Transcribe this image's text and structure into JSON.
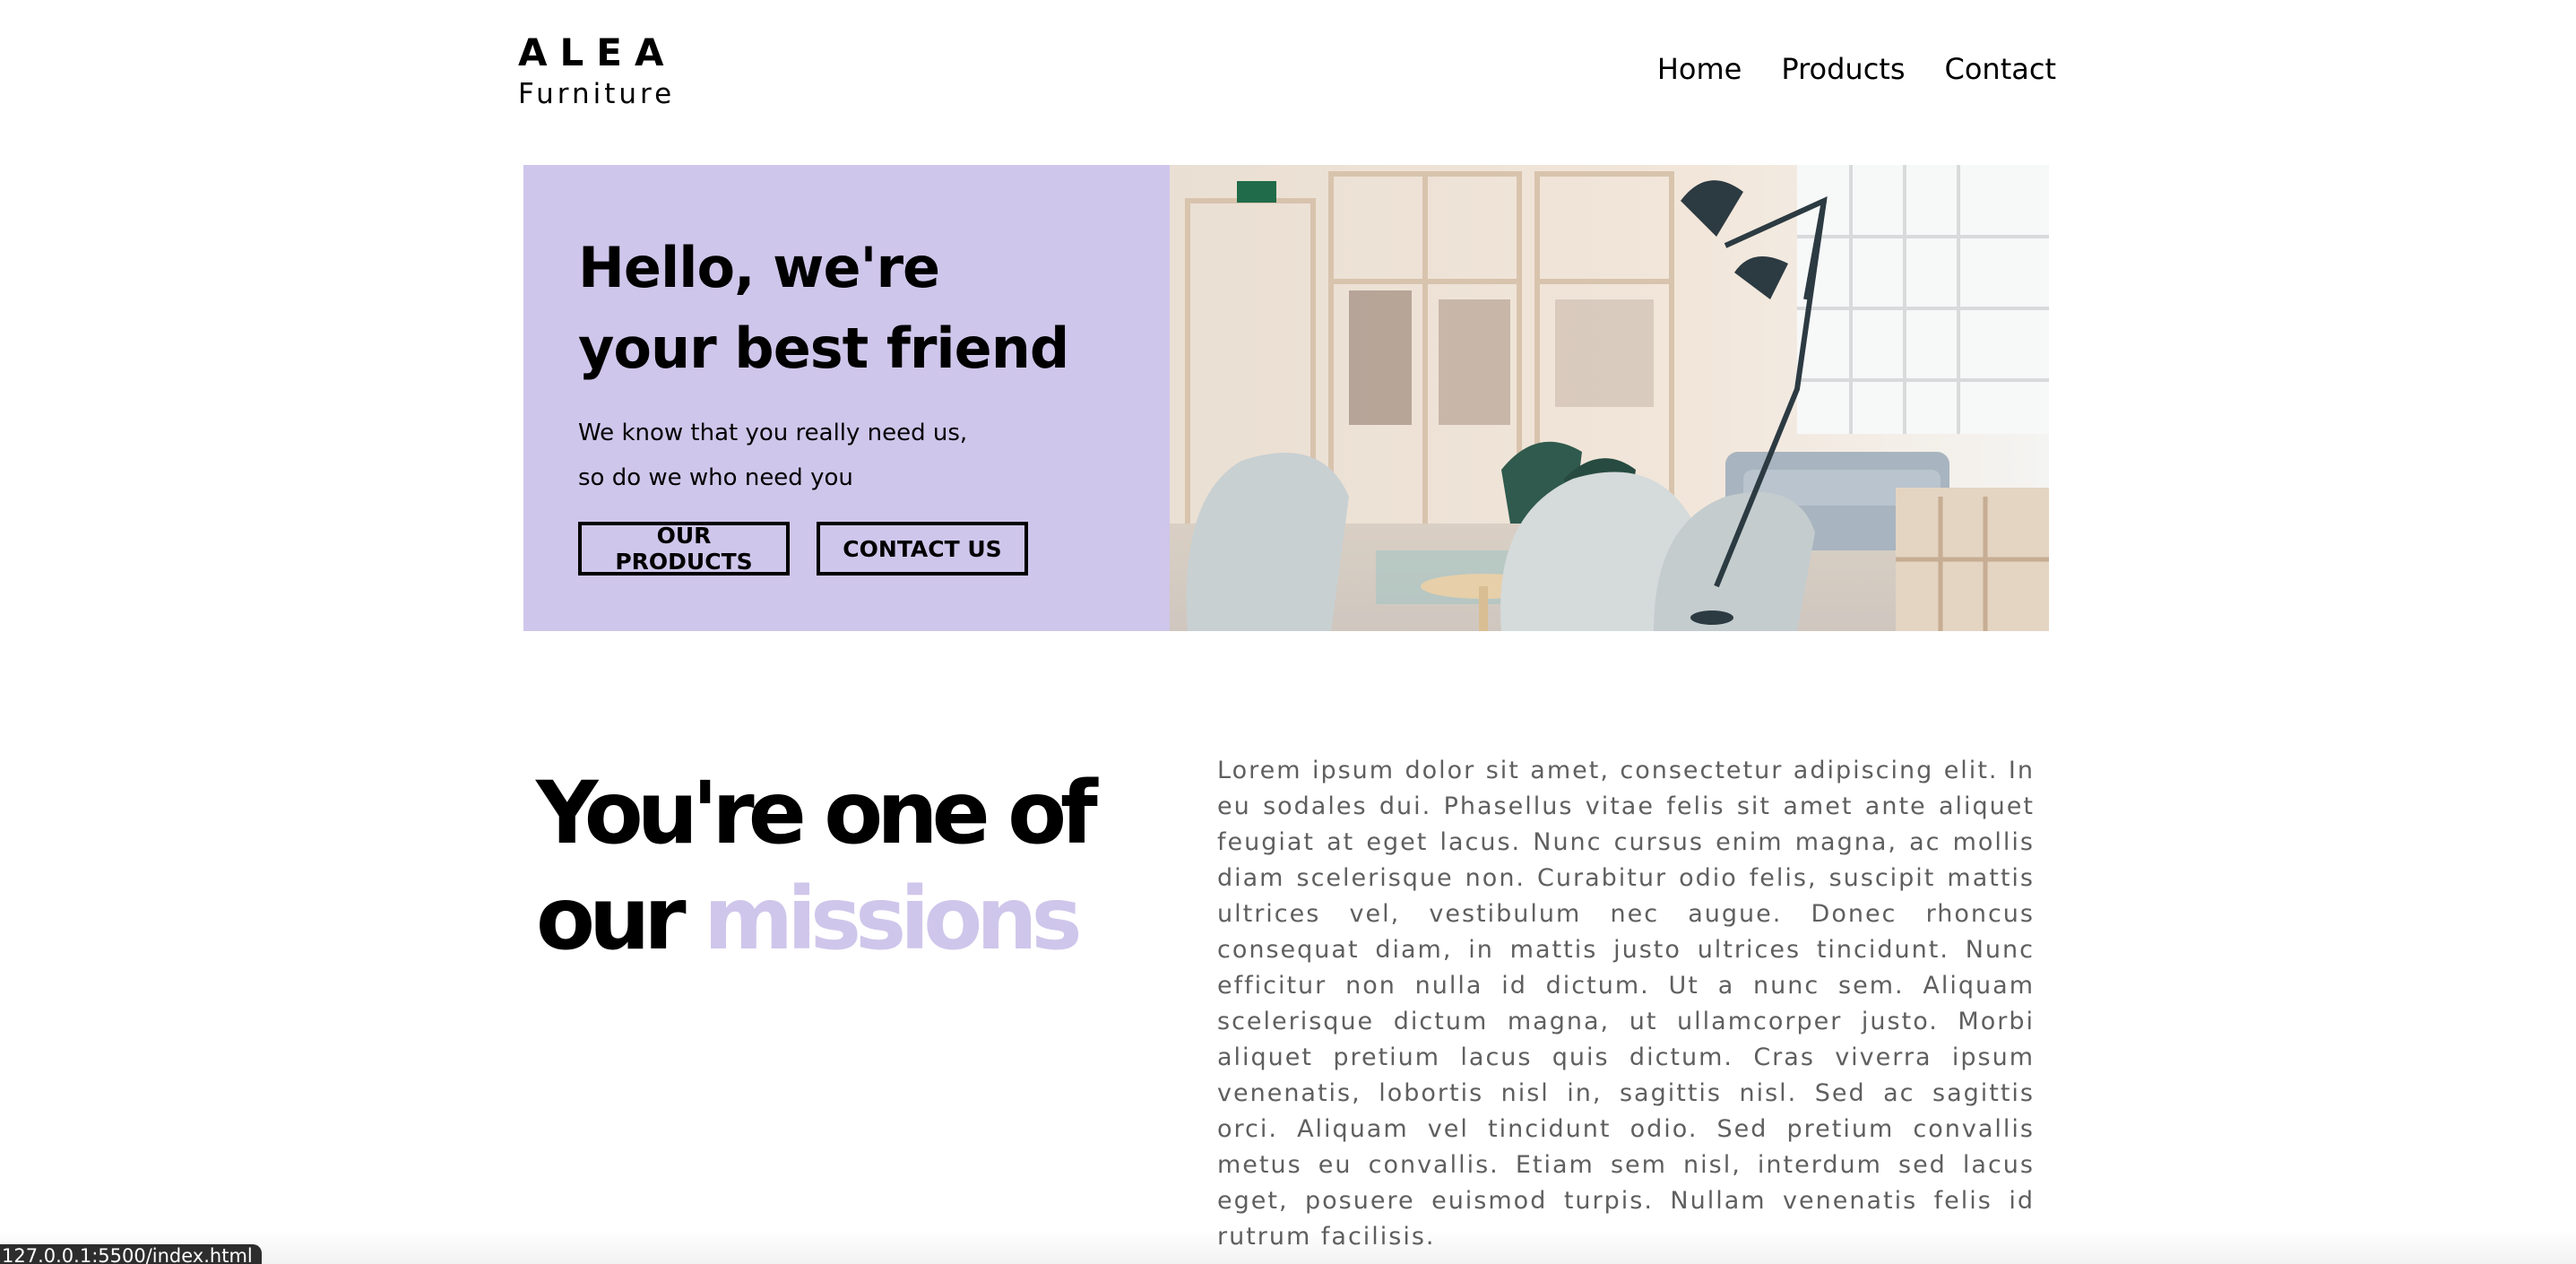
{
  "header": {
    "logo_mark": "ALEA",
    "logo_sub": "Furniture",
    "nav": [
      {
        "label": "Home"
      },
      {
        "label": "Products"
      },
      {
        "label": "Contact"
      }
    ]
  },
  "hero": {
    "title_line1": "Hello, we're",
    "title_line2": "your best friend",
    "text_line1": "We know that you really need us,",
    "text_line2": "so do we who need you",
    "primary_button": "OUR PRODUCTS",
    "secondary_button": "CONTACT US",
    "image_icon": "interior-photo"
  },
  "mission": {
    "title_line1": "You're one of",
    "title_word": "our",
    "title_accent": "missions",
    "body": "Lorem ipsum dolor sit amet, consectetur adipiscing elit. In eu sodales dui. Phasellus vitae felis sit amet ante aliquet feugiat at eget lacus. Nunc cursus enim magna, ac mollis diam scelerisque non. Curabitur odio felis, suscipit mattis ultrices vel, vestibulum nec augue. Donec rhoncus consequat diam, in mattis justo ultrices tincidunt. Nunc efficitur non nulla id dictum. Ut a nunc sem. Aliquam scelerisque dictum magna, ut ullamcorper justo. Morbi aliquet pretium lacus quis dictum. Cras viverra ipsum venenatis, lobortis nisl in, sagittis nisl. Sed ac sagittis orci. Aliquam vel tincidunt odio. Sed pretium convallis metus eu convallis. Etiam sem nisl, interdum sed lacus eget, posuere euismod turpis. Nullam venenatis felis id rutrum facilisis."
  },
  "status_bar": {
    "url": "127.0.0.1:5500/index.html"
  },
  "colors": {
    "accent": "#cfc6eb",
    "text": "#000000",
    "body_text": "#5f5f5f"
  }
}
